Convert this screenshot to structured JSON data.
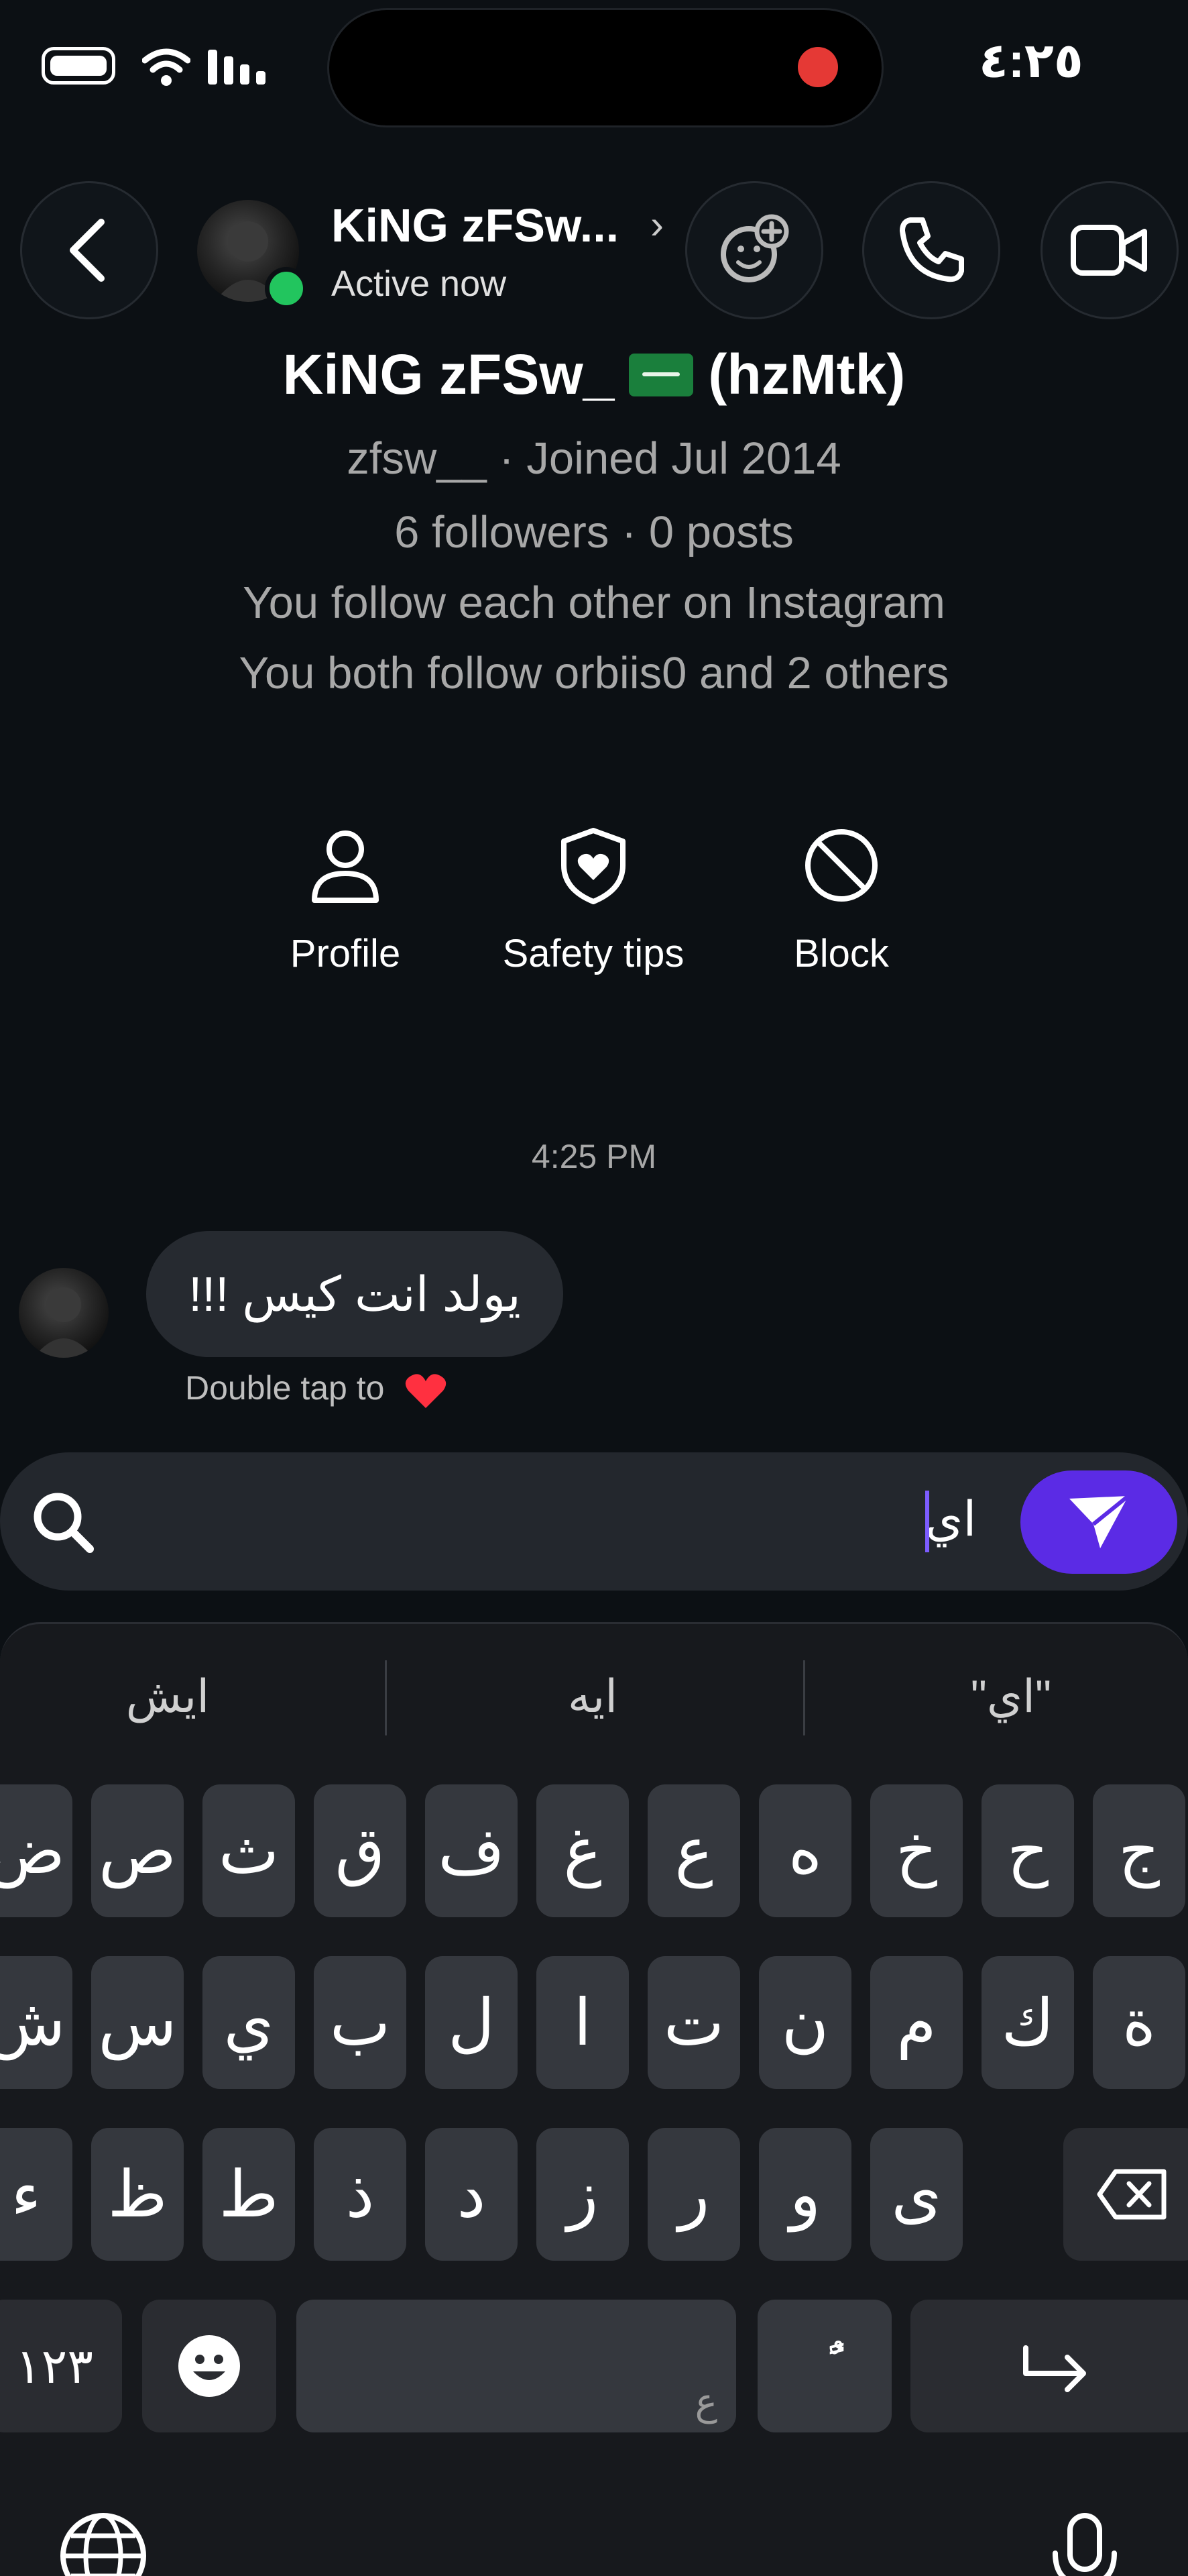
{
  "status_bar": {
    "time": "٤:٢٥",
    "recording": true
  },
  "header": {
    "contact_name": "KiNG zFSw...",
    "status": "Active now",
    "back_icon": "chevron-left-icon",
    "actions": [
      "add-effect-icon",
      "phone-icon",
      "video-icon"
    ]
  },
  "profile": {
    "display_name": "KiNG zFSw_",
    "nickname": "(hzMtk)",
    "username_line": "zfsw__ · Joined Jul 2014",
    "stats_line": "6 followers · 0 posts",
    "mutual_line": "You follow each other on Instagram",
    "common_line": "You both follow orbiis0 and 2 others"
  },
  "profile_actions": [
    {
      "label": "Profile",
      "icon": "person-icon"
    },
    {
      "label": "Safety tips",
      "icon": "shield-heart-icon"
    },
    {
      "label": "Block",
      "icon": "block-icon"
    }
  ],
  "chat": {
    "timestamp": "4:25 PM",
    "message": "يولد انت كيس !!!",
    "hint": "Double tap to"
  },
  "composer": {
    "text": "اي",
    "search_icon": "search-icon",
    "send_icon": "send-icon"
  },
  "keyboard": {
    "suggestions": [
      "ايش",
      "ايه",
      "\"اي\""
    ],
    "row1": [
      "ض",
      "ص",
      "ث",
      "ق",
      "ف",
      "غ",
      "ع",
      "ه",
      "خ",
      "ح",
      "ج"
    ],
    "row2": [
      "ش",
      "س",
      "ي",
      "ب",
      "ل",
      "ا",
      "ت",
      "ن",
      "م",
      "ك",
      "ة"
    ],
    "row3": [
      "ء",
      "ظ",
      "ط",
      "ذ",
      "د",
      "ز",
      "ر",
      "و",
      "ى"
    ],
    "numbers_key": "١٢٣",
    "space_hint": "ع",
    "diacritic_key": "ًٌ"
  },
  "colors": {
    "background": "#0c1014",
    "accent": "#5b2be5",
    "online": "#22c55e",
    "bubble": "#262a30",
    "key": "#35383e"
  }
}
